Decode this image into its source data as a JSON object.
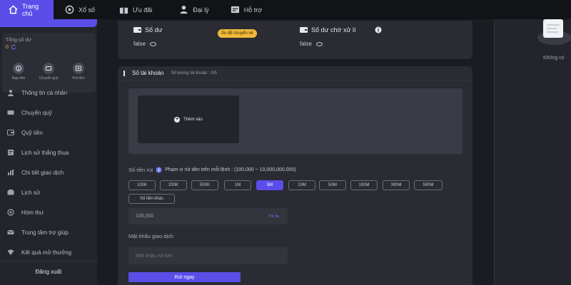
{
  "nav": [
    {
      "label": "Trang chủ",
      "icon": "home-icon",
      "active": true
    },
    {
      "label": "Xổ số",
      "icon": "lottery-icon",
      "active": false
    },
    {
      "label": "Ưu đãi",
      "icon": "gift-icon",
      "active": false
    },
    {
      "label": "Đại lý",
      "icon": "agent-icon",
      "active": false
    },
    {
      "label": "Hỗ trợ",
      "icon": "support-icon",
      "active": false
    }
  ],
  "sidebar": {
    "balance_label": "Tổng số dư",
    "balance_value": "0",
    "quick_actions": [
      {
        "label": "Nạp tiền",
        "icon": "deposit-icon"
      },
      {
        "label": "Chuyển quỹ",
        "icon": "transfer-icon"
      },
      {
        "label": "Rút tiền",
        "icon": "withdraw-icon"
      }
    ],
    "items": [
      {
        "label": "Thông tin cá nhân",
        "icon": "user-icon"
      },
      {
        "label": "Chuyển quỹ",
        "icon": "transfer-icon"
      },
      {
        "label": "Quỹ tiền",
        "icon": "wallet-icon"
      },
      {
        "label": "Lịch sử thắng thua",
        "icon": "history-icon"
      },
      {
        "label": "Chi tiết giao dịch",
        "icon": "transaction-icon"
      },
      {
        "label": "Lịch sử",
        "icon": "clock-icon"
      },
      {
        "label": "Hòm thư",
        "icon": "mail-icon"
      },
      {
        "label": "Trung tâm trợ giúp",
        "icon": "help-icon"
      },
      {
        "label": "Kết quả mở thưởng",
        "icon": "trophy-icon"
      }
    ],
    "logout": "Đăng xuất"
  },
  "balances": {
    "balance_label": "Số dư",
    "balance_value": "false",
    "hide_badge": "Ấn để chuyển về",
    "pending_label": "Số dư chờ xử lí",
    "pending_value": "false"
  },
  "withdraw": {
    "title": "Số tài khoản",
    "count_label": "Số lượng tài khoản : 0/5",
    "add_card": "Thêm vào",
    "amount_label": "Số tiền rút",
    "range_label": "Phạm vi rút tiền trên mỗi lệnh : (100,000 ~ 10,000,000,000)",
    "chips": [
      "100K",
      "200K",
      "500K",
      "1M",
      "5M",
      "10M",
      "50M",
      "100M",
      "300M",
      "500M",
      "Số tiền khác"
    ],
    "active_chip": "5M",
    "amount_value": "100,000",
    "max_label": "Tối đa",
    "password_label": "Mật khẩu giao dịch",
    "password_placeholder": "Mật khẩu rút tiền",
    "submit": "Rút ngay"
  },
  "right_panel": {
    "empty_text": "Không có"
  },
  "colors": {
    "accent": "#5b4de8",
    "badge": "#f0b93a",
    "background": "#1b1c22"
  }
}
